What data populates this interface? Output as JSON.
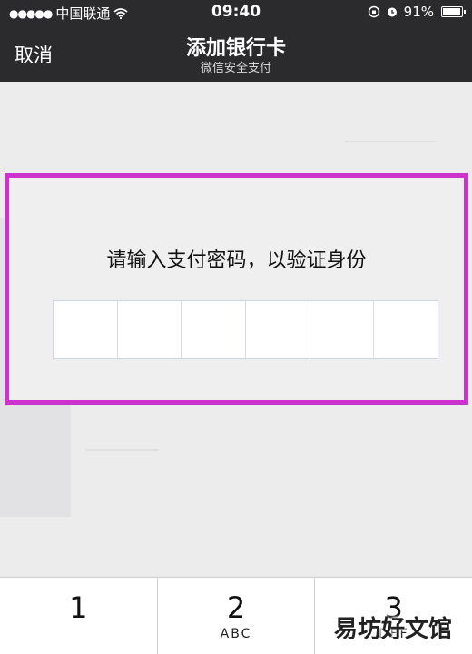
{
  "status": {
    "carrier": "中国联通",
    "time": "09:40",
    "battery": "91%"
  },
  "nav": {
    "cancel": "取消",
    "title": "添加银行卡",
    "subtitle": "微信安全支付"
  },
  "dialog": {
    "prompt": "请输入支付密码，以验证身份",
    "pin_digits": [
      "",
      "",
      "",
      "",
      "",
      ""
    ]
  },
  "keypad": {
    "keys": [
      {
        "digit": "1",
        "letters": ""
      },
      {
        "digit": "2",
        "letters": "ABC"
      },
      {
        "digit": "3",
        "letters": "DEF"
      }
    ]
  },
  "watermark": "易坊好文馆",
  "colors": {
    "highlight": "#cc33cc",
    "nav_background": "#2b2b2d"
  }
}
